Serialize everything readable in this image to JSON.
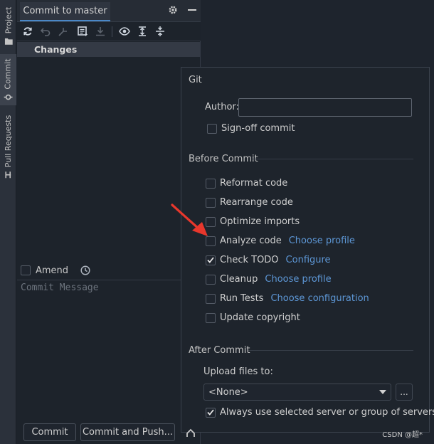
{
  "sidebar": {
    "tabs": [
      {
        "label": "Project",
        "icon": "folder-icon"
      },
      {
        "label": "Commit",
        "icon": "commit-icon",
        "active": true
      },
      {
        "label": "Pull Requests",
        "icon": "pull-request-icon"
      }
    ]
  },
  "commit_panel": {
    "tab_title": "Commit to master",
    "toolbar_icons": [
      "refresh-icon",
      "rollback-icon",
      "shelve-icon",
      "diff-icon",
      "download-icon",
      "eye-icon",
      "expand-all-icon",
      "collapse-all-icon"
    ],
    "changes_header": "Changes",
    "amend_label": "Amend",
    "commit_message_placeholder": "Commit Message",
    "commit_button": "Commit",
    "commit_push_button": "Commit and Push..."
  },
  "commit_options": {
    "git_section": {
      "title": "Git",
      "author_label": "Author:",
      "author_value": "",
      "signoff_label": "Sign-off commit",
      "signoff_checked": false
    },
    "before_commit": {
      "title": "Before Commit",
      "items": [
        {
          "label": "Reformat code",
          "link": "",
          "checked": false
        },
        {
          "label": "Rearrange code",
          "link": "",
          "checked": false
        },
        {
          "label": "Optimize imports",
          "link": "",
          "checked": false
        },
        {
          "label": "Analyze code",
          "link": "Choose profile",
          "checked": false
        },
        {
          "label": "Check TODO",
          "link": "Configure",
          "checked": true
        },
        {
          "label": "Cleanup",
          "link": "Choose profile",
          "checked": false
        },
        {
          "label": "Run Tests",
          "link": "Choose configuration",
          "checked": false
        },
        {
          "label": "Update copyright",
          "link": "",
          "checked": false
        }
      ]
    },
    "after_commit": {
      "title": "After Commit",
      "upload_label": "Upload files to:",
      "upload_selected": "<None>",
      "browse_label": "...",
      "always_use_label": "Always use selected server or group of servers",
      "always_use_checked": true
    }
  },
  "watermark": "CSDN @超*",
  "colors": {
    "accent": "#4a88c7",
    "link": "#5d97d6",
    "arrow": "#e8372c"
  }
}
